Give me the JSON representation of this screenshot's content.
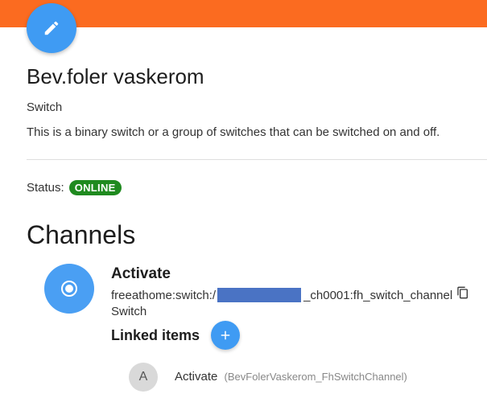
{
  "thing": {
    "title": "Bev.foler vaskerom",
    "type": "Switch",
    "description": "This is a binary switch or a group of switches that can be switched on and off."
  },
  "status": {
    "label": "Status:",
    "value": "ONLINE",
    "color": "#1f8a1f"
  },
  "channels": {
    "heading": "Channels",
    "items": [
      {
        "label": "Activate",
        "uid_prefix": "freeathome:switch:/",
        "uid_suffix": "_ch0001:fh_switch_channel",
        "type": "Switch",
        "linked_items_label": "Linked items",
        "linked_items": [
          {
            "avatar": "A",
            "label": "Activate",
            "item_id": "(BevFolerVaskerom_FhSwitchChannel)"
          }
        ]
      }
    ]
  },
  "colors": {
    "topbar": "#fb6b20",
    "accent": "#3f9bf3"
  },
  "icons": {
    "edit": "pencil-icon",
    "channel": "radio-button-icon",
    "copy": "copy-icon",
    "add": "plus-icon"
  }
}
